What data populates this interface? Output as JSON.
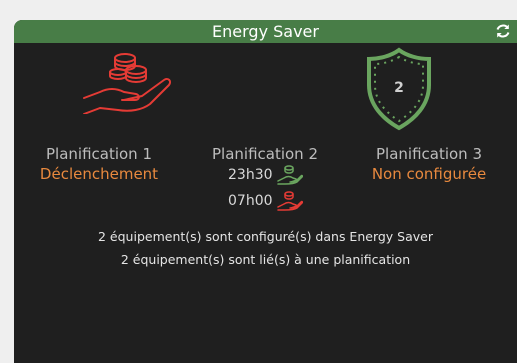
{
  "widget": {
    "title": "Energy Saver",
    "refresh_icon": "refresh-icon"
  },
  "plans": [
    {
      "label": "Planification 1",
      "status": "Déclenchement",
      "icon": "hand-coins-icon"
    },
    {
      "label": "Planification 2",
      "times": [
        "23h30",
        "07h00"
      ]
    },
    {
      "label": "Planification 3",
      "status": "Non configurée",
      "icon": "shield-icon",
      "shield_number": "2"
    }
  ],
  "info": {
    "line1": "2 équipement(s) sont configuré(s) dans Energy Saver",
    "line2": "2 équipement(s) sont lié(s) à une planification"
  },
  "colors": {
    "header": "#487d47",
    "panel": "#1f1f1f",
    "status": "#e8893e",
    "icon_red": "#e53b35",
    "icon_green": "#6aa55f"
  }
}
